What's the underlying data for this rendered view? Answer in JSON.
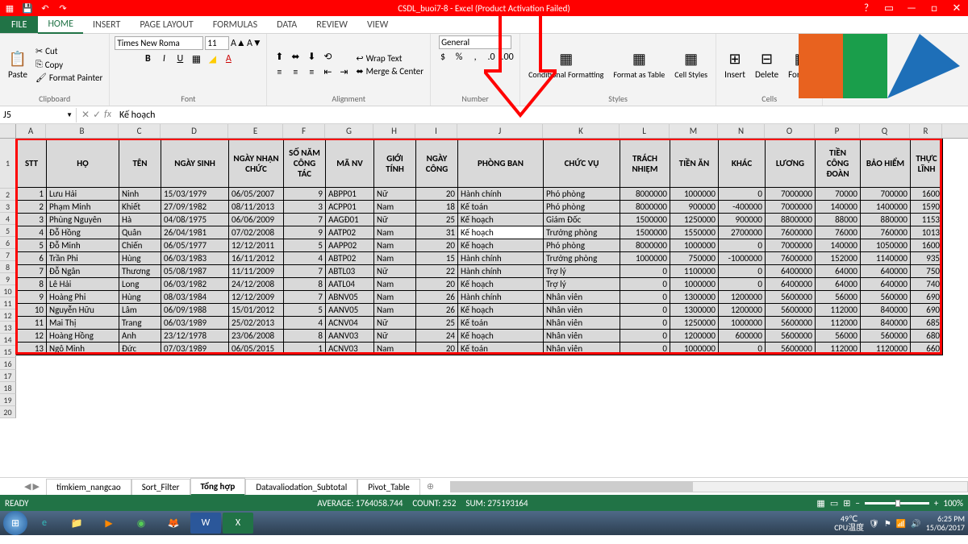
{
  "titlebar": {
    "title": "CSDL_buoi7-8 - Excel (Product Activation Failed)"
  },
  "ribbon_tabs": {
    "file": "FILE",
    "home": "HOME",
    "insert": "INSERT",
    "page_layout": "PAGE LAYOUT",
    "formulas": "FORMULAS",
    "data": "DATA",
    "review": "REVIEW",
    "view": "VIEW"
  },
  "ribbon": {
    "clipboard": {
      "paste": "Paste",
      "cut": "Cut",
      "copy": "Copy",
      "fp": "Format Painter",
      "label": "Clipboard"
    },
    "font": {
      "name": "Times New Roma",
      "size": "11",
      "label": "Font"
    },
    "alignment": {
      "wrap": "Wrap Text",
      "merge": "Merge & Center",
      "label": "Alignment"
    },
    "number": {
      "fmt": "General",
      "label": "Number"
    },
    "styles": {
      "cf": "Conditional Formatting",
      "ft": "Format as Table",
      "cs": "Cell Styles",
      "label": "Styles"
    },
    "cells": {
      "ins": "Insert",
      "del": "Delete",
      "fmt": "Format",
      "label": "Cells"
    }
  },
  "formula_bar": {
    "name": "J5",
    "value": "Kế hoạch"
  },
  "columns": [
    "A",
    "B",
    "C",
    "D",
    "E",
    "F",
    "G",
    "H",
    "I",
    "J",
    "K",
    "L",
    "M",
    "N",
    "O",
    "P",
    "Q",
    "R"
  ],
  "headers": [
    "STT",
    "HỌ",
    "TÊN",
    "NGÀY SINH",
    "NGÀY NHẬN CHỨC",
    "SỐ NĂM CÔNG TÁC",
    "MÃ NV",
    "GIỚI TÍNH",
    "NGÀY CÔNG",
    "PHÒNG BAN",
    "CHỨC VỤ",
    "TRÁCH NHIỆM",
    "TIỀN ĂN",
    "KHÁC",
    "LƯƠNG",
    "TIỀN CÔNG ĐOÀN",
    "BẢO HIỂM",
    "THỰC LĨNH"
  ],
  "rows": [
    [
      1,
      "Lưu Hải",
      "Ninh",
      "15/03/1979",
      "06/05/2007",
      9,
      "ABPP01",
      "Nữ",
      20,
      "Hành chính",
      "Phó phòng",
      8000000,
      1000000,
      0,
      7000000,
      70000,
      700000,
      1600
    ],
    [
      2,
      "Phạm Minh",
      "Khiết",
      "27/09/1982",
      "08/11/2013",
      3,
      "ACPP01",
      "Nam",
      18,
      "Kế toán",
      "Phó phòng",
      8000000,
      900000,
      -400000,
      7000000,
      140000,
      1400000,
      1590
    ],
    [
      3,
      "Phùng Nguyên",
      "Hà",
      "04/08/1975",
      "06/06/2009",
      7,
      "AAGĐ01",
      "Nữ",
      25,
      "Kế hoạch",
      "Giám Đốc",
      1500000,
      1250000,
      900000,
      8800000,
      88000,
      880000,
      1153
    ],
    [
      4,
      "Đỗ Hồng",
      "Quân",
      "26/04/1981",
      "07/02/2008",
      9,
      "AATP02",
      "Nam",
      31,
      "Kế hoạch",
      "Trưởng phòng",
      1500000,
      1550000,
      2700000,
      7600000,
      76000,
      760000,
      1013
    ],
    [
      5,
      "Đỗ Minh",
      "Chiến",
      "06/05/1977",
      "12/12/2011",
      5,
      "AAPP02",
      "Nam",
      20,
      "Kế hoạch",
      "Phó phòng",
      8000000,
      1000000,
      0,
      7000000,
      140000,
      1050000,
      1600
    ],
    [
      6,
      "Trần Phi",
      "Hùng",
      "06/03/1983",
      "16/11/2012",
      4,
      "ABTP02",
      "Nam",
      15,
      "Hành chính",
      "Trưởng phòng",
      1000000,
      750000,
      -1000000,
      7600000,
      152000,
      1140000,
      935
    ],
    [
      7,
      "Đỗ Ngân",
      "Thương",
      "05/08/1987",
      "11/11/2009",
      7,
      "ABTL03",
      "Nữ",
      22,
      "Hành chính",
      "Trợ lý",
      0,
      1100000,
      0,
      6400000,
      64000,
      640000,
      750
    ],
    [
      8,
      "Lê Hải",
      "Long",
      "06/03/1982",
      "24/12/2008",
      8,
      "AATL04",
      "Nam",
      20,
      "Kế hoạch",
      "Trợ lý",
      0,
      1000000,
      0,
      6400000,
      64000,
      640000,
      740
    ],
    [
      9,
      "Hoàng Phi",
      "Hùng",
      "08/03/1984",
      "12/12/2009",
      7,
      "ABNV05",
      "Nam",
      26,
      "Hành chính",
      "Nhân viên",
      0,
      1300000,
      1200000,
      5600000,
      56000,
      560000,
      690
    ],
    [
      10,
      "Nguyễn Hữu",
      "Lâm",
      "06/09/1988",
      "15/01/2012",
      5,
      "AANV05",
      "Nam",
      26,
      "Kế hoạch",
      "Nhân viên",
      0,
      1300000,
      1200000,
      5600000,
      112000,
      840000,
      690
    ],
    [
      11,
      "Mai Thị",
      "Trang",
      "06/03/1989",
      "25/02/2013",
      4,
      "ACNV04",
      "Nữ",
      25,
      "Kế toán",
      "Nhân viên",
      0,
      1250000,
      1000000,
      5600000,
      112000,
      840000,
      685
    ],
    [
      12,
      "Hoàng Hồng",
      "Anh",
      "23/12/1978",
      "23/06/2008",
      8,
      "AANV03",
      "Nữ",
      24,
      "Kế hoạch",
      "Nhân viên",
      0,
      1200000,
      600000,
      5600000,
      56000,
      560000,
      680
    ],
    [
      13,
      "Ngô Minh",
      "Đức",
      "07/03/1989",
      "06/05/2015",
      1,
      "ACNV03",
      "Nam",
      20,
      "Kế toán",
      "Nhân viên",
      0,
      1000000,
      0,
      5600000,
      112000,
      1120000,
      660
    ]
  ],
  "sheets": {
    "s1": "timkiem_nangcao",
    "s2": "Sort_Filter",
    "s3": "Tổng hợp",
    "s4": "Datavaliodation_Subtotal",
    "s5": "Pivot_Table"
  },
  "statusbar": {
    "ready": "READY",
    "avg": "AVERAGE: 1764058.744",
    "count": "COUNT: 252",
    "sum": "SUM: 275193164",
    "zoom": "100%"
  },
  "taskbar": {
    "temp": "49℃",
    "cpu": "CPU温度",
    "time": "6:25 PM",
    "date": "15/06/2017"
  }
}
